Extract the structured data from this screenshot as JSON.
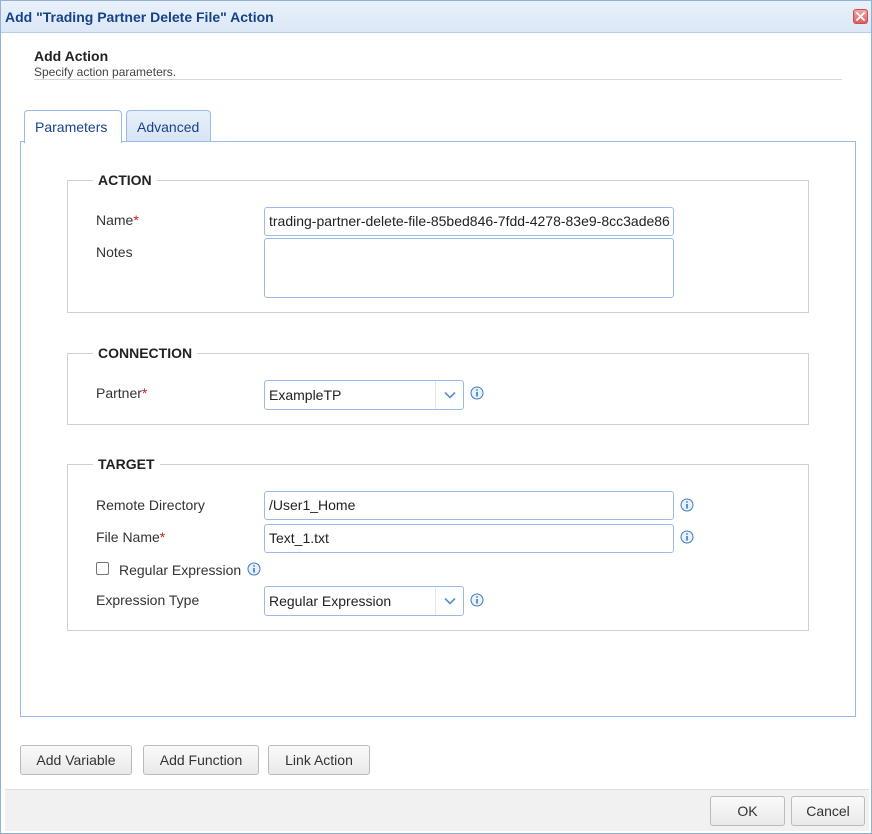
{
  "window": {
    "title": "Add \"Trading Partner Delete File\" Action"
  },
  "header": {
    "title": "Add Action",
    "subtitle": "Specify action parameters."
  },
  "tabs": [
    {
      "label": "Parameters",
      "active": true
    },
    {
      "label": "Advanced",
      "active": false
    }
  ],
  "action_section": {
    "legend": "ACTION",
    "name_label": "Name",
    "name_value": "trading-partner-delete-file-85bed846-7fdd-4278-83e9-8cc3ade86",
    "notes_label": "Notes",
    "notes_value": ""
  },
  "connection_section": {
    "legend": "CONNECTION",
    "partner_label": "Partner",
    "partner_value": "ExampleTP"
  },
  "target_section": {
    "legend": "TARGET",
    "remote_dir_label": "Remote Directory",
    "remote_dir_value": "/User1_Home",
    "file_name_label": "File Name",
    "file_name_value": "Text_1.txt",
    "regex_label": "Regular Expression",
    "regex_checked": false,
    "expr_type_label": "Expression Type",
    "expr_type_value": "Regular Expression"
  },
  "required_marker": "*",
  "toolbar": {
    "add_variable": "Add Variable",
    "add_function": "Add Function",
    "link_action": "Link Action"
  },
  "footer": {
    "ok": "OK",
    "cancel": "Cancel"
  },
  "colors": {
    "title_text": "#15428b",
    "border_accent": "#99bbe8",
    "required": "#d21a1a",
    "info_icon": "#3a78c2"
  },
  "icons": {
    "close": "close-icon",
    "info": "info-icon",
    "dropdown": "chevron-down-icon"
  }
}
